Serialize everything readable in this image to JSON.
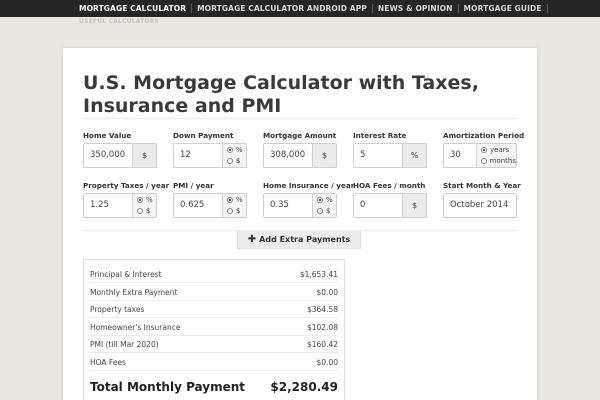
{
  "nav": {
    "items": [
      {
        "label": "MORTGAGE CALCULATOR",
        "active": true
      },
      {
        "label": "MORTGAGE CALCULATOR ANDROID APP",
        "active": false
      },
      {
        "label": "NEWS & OPINION",
        "active": false
      },
      {
        "label": "MORTGAGE GUIDE",
        "active": false
      }
    ],
    "sub_label": "USEFUL CALCULATORS"
  },
  "page": {
    "title": "U.S. Mortgage Calculator with Taxes, Insurance and PMI"
  },
  "form": {
    "home_value": {
      "label": "Home Value",
      "value": "350,000",
      "unit": "$"
    },
    "down_payment": {
      "label": "Down Payment",
      "value": "12",
      "opt1": "%",
      "opt2": "$",
      "selected": "%"
    },
    "mortgage_amount": {
      "label": "Mortgage Amount",
      "value": "308,000",
      "unit": "$"
    },
    "interest_rate": {
      "label": "Interest Rate",
      "value": "5",
      "unit": "%"
    },
    "amortization": {
      "label": "Amortization Period",
      "value": "30",
      "opt1": "years",
      "opt2": "months",
      "selected": "years"
    },
    "property_taxes": {
      "label": "Property Taxes / year",
      "value": "1.25",
      "opt1": "%",
      "opt2": "$",
      "selected": "%"
    },
    "pmi": {
      "label": "PMI / year",
      "value": "0.625",
      "opt1": "%",
      "opt2": "$",
      "selected": "%"
    },
    "home_insurance": {
      "label": "Home Insurance / year",
      "value": "0.35",
      "opt1": "%",
      "opt2": "$",
      "selected": "%"
    },
    "hoa_fees": {
      "label": "HOA Fees / month",
      "value": "0",
      "unit": "$"
    },
    "start_month": {
      "label": "Start Month & Year",
      "value": "October 2014"
    }
  },
  "extra_payments_button": {
    "label": "Add Extra Payments",
    "icon": "plus-icon"
  },
  "results": {
    "rows": [
      {
        "label": "Principal & Interest",
        "value": "$1,653.41"
      },
      {
        "label": "Monthly Extra Payment",
        "value": "$0.00"
      },
      {
        "label": "Property taxes",
        "value": "$364.58"
      },
      {
        "label": "Homeowner's Insurance",
        "value": "$102.08"
      },
      {
        "label": "PMI (till Mar 2020)",
        "value": "$160.42"
      },
      {
        "label": "HOA Fees",
        "value": "$0.00"
      }
    ],
    "total": {
      "label": "Total Monthly Payment",
      "value": "$2,280.49"
    }
  }
}
